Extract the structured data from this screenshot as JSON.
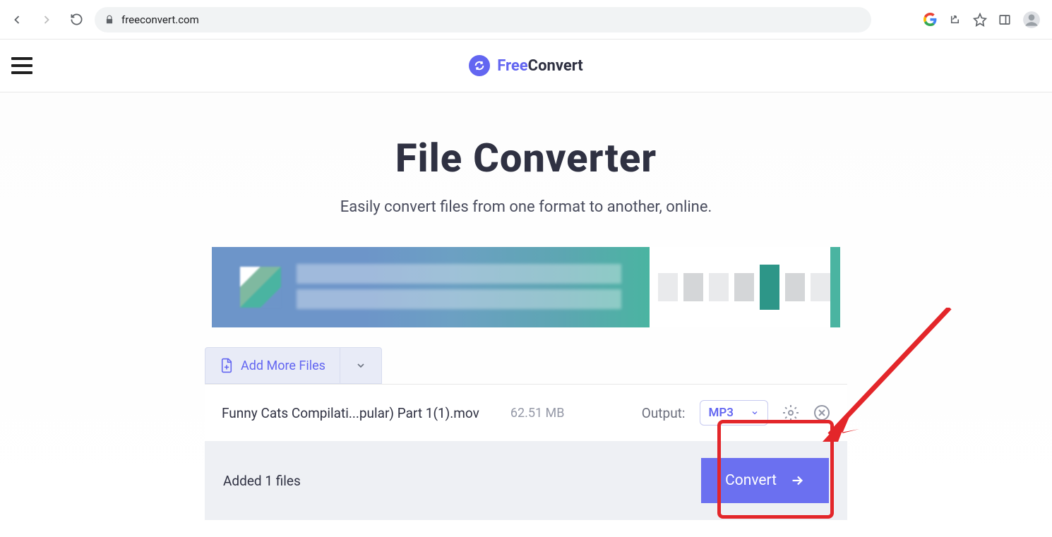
{
  "url": "freeconvert.com",
  "logo": {
    "free": "Free",
    "convert": "Convert"
  },
  "hero": {
    "title": "File Converter",
    "subtitle": "Easily convert files from one format to another, online."
  },
  "addFiles": {
    "label": "Add More Files"
  },
  "file": {
    "name": "Funny Cats Compilati...pular) Part 1(1).mov",
    "size": "62.51 MB",
    "outputLabel": "Output:",
    "outputFormat": "MP3"
  },
  "footer": {
    "added": "Added 1 files",
    "convert": "Convert"
  }
}
